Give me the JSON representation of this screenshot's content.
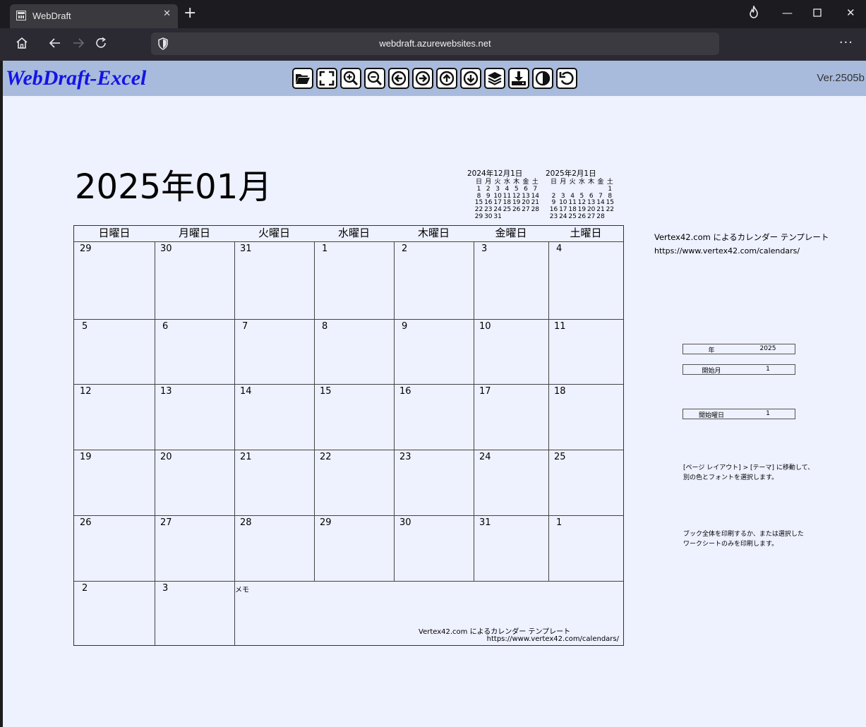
{
  "browser": {
    "tab_title": "WebDraft",
    "url": "webdraft.azurewebsites.net"
  },
  "app": {
    "brand": "WebDraft-Excel",
    "version": "Ver.2505b",
    "toolbar_icons": [
      "open-folder-icon",
      "fullscreen-icon",
      "zoom-in-icon",
      "zoom-out-icon",
      "arrow-left-icon",
      "arrow-right-icon",
      "arrow-up-icon",
      "arrow-down-icon",
      "layers-icon",
      "download-icon",
      "contrast-icon",
      "undo-icon"
    ]
  },
  "sheet": {
    "title": "2025年01月",
    "mini_prev": {
      "title": "2024年12月1日",
      "weekdays": [
        "日",
        "月",
        "火",
        "水",
        "木",
        "金",
        "土"
      ],
      "rows": [
        [
          "1",
          "2",
          "3",
          "4",
          "5",
          "6",
          "7"
        ],
        [
          "8",
          "9",
          "10",
          "11",
          "12",
          "13",
          "14"
        ],
        [
          "15",
          "16",
          "17",
          "18",
          "19",
          "20",
          "21"
        ],
        [
          "22",
          "23",
          "24",
          "25",
          "26",
          "27",
          "28"
        ],
        [
          "29",
          "30",
          "31",
          "",
          "",
          "",
          ""
        ]
      ]
    },
    "mini_next": {
      "title": "2025年2月1日",
      "weekdays": [
        "日",
        "月",
        "火",
        "水",
        "木",
        "金",
        "土"
      ],
      "rows": [
        [
          "",
          "",
          "",
          "",
          "",
          "",
          "1"
        ],
        [
          "2",
          "3",
          "4",
          "5",
          "6",
          "7",
          "8"
        ],
        [
          "9",
          "10",
          "11",
          "12",
          "13",
          "14",
          "15"
        ],
        [
          "16",
          "17",
          "18",
          "19",
          "20",
          "21",
          "22"
        ],
        [
          "23",
          "24",
          "25",
          "26",
          "27",
          "28",
          ""
        ]
      ]
    },
    "weekday_headers": [
      "日曜日",
      "月曜日",
      "火曜日",
      "水曜日",
      "木曜日",
      "金曜日",
      "土曜日"
    ],
    "weeks": [
      [
        "29",
        "30",
        "31",
        "1",
        "2",
        "3",
        "4"
      ],
      [
        "5",
        "6",
        "7",
        "8",
        "9",
        "10",
        "11"
      ],
      [
        "12",
        "13",
        "14",
        "15",
        "16",
        "17",
        "18"
      ],
      [
        "19",
        "20",
        "21",
        "22",
        "23",
        "24",
        "25"
      ],
      [
        "26",
        "27",
        "28",
        "29",
        "30",
        "31",
        "1"
      ],
      [
        "2",
        "3",
        "",
        "",
        "",
        "",
        ""
      ]
    ],
    "memo_label": "メモ",
    "credit_line1": "Vertex42.com によるカレンダー テンプレート",
    "credit_line2": "https://www.vertex42.com/calendars/",
    "side_credit1": "Vertex42.com によるカレンダー テンプレート",
    "side_credit2": "https://www.vertex42.com/calendars/",
    "fields": [
      {
        "label": "年",
        "value": "2025"
      },
      {
        "label": "開始月",
        "value": "1"
      },
      {
        "label": "開始曜日",
        "value": "1"
      }
    ],
    "note1_line1": "[ページ レイアウト] > [テーマ] に移動して、",
    "note1_line2": "別の色とフォントを選択します。",
    "note2_line1": "ブック全体を印刷するか、または選択した",
    "note2_line2": "ワークシートのみを印刷します。"
  }
}
